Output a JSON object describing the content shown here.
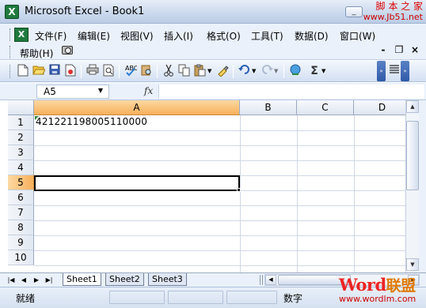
{
  "window": {
    "title": "Microsoft Excel - Book1",
    "app_icon": "excel-icon",
    "minimize": "_",
    "maximize": "□",
    "close": "×",
    "watermark_line1": "脚 本 之 家",
    "watermark_line2": "www.Jb51.net"
  },
  "menu": {
    "items": [
      "文件(F)",
      "编辑(E)",
      "视图(V)",
      "插入(I)",
      "格式(O)",
      "工具(T)",
      "数据(D)",
      "窗口(W)"
    ],
    "help": "帮助(H)",
    "mdi_min": "-",
    "mdi_restore": "❐",
    "mdi_close": "×"
  },
  "toolbar": {
    "icons": [
      "new-icon",
      "open-icon",
      "save-icon",
      "permission-icon",
      "print-icon",
      "print-preview-icon",
      "spelling-icon",
      "research-icon",
      "cut-icon",
      "copy-icon",
      "paste-icon",
      "format-painter-icon",
      "undo-icon",
      "redo-icon",
      "hyperlink-icon",
      "autosum-icon",
      "align-icon"
    ],
    "autosum": "Σ"
  },
  "formula_bar": {
    "name_box": "A5",
    "fx": "fx",
    "formula": ""
  },
  "grid": {
    "columns": [
      "A",
      "B",
      "C",
      "D"
    ],
    "active_column": "A",
    "rows": [
      "1",
      "2",
      "3",
      "4",
      "5",
      "6",
      "7",
      "8",
      "9",
      "10"
    ],
    "active_row": "5",
    "cells": {
      "A1": "421221198005110000"
    }
  },
  "sheets": {
    "tabs": [
      "Sheet1",
      "Sheet2",
      "Sheet3"
    ],
    "active": "Sheet1"
  },
  "status": {
    "ready": "就绪",
    "num": "数字"
  },
  "branding": {
    "word": "Word",
    "cn": "联盟",
    "url": "www.wordlm.com"
  }
}
